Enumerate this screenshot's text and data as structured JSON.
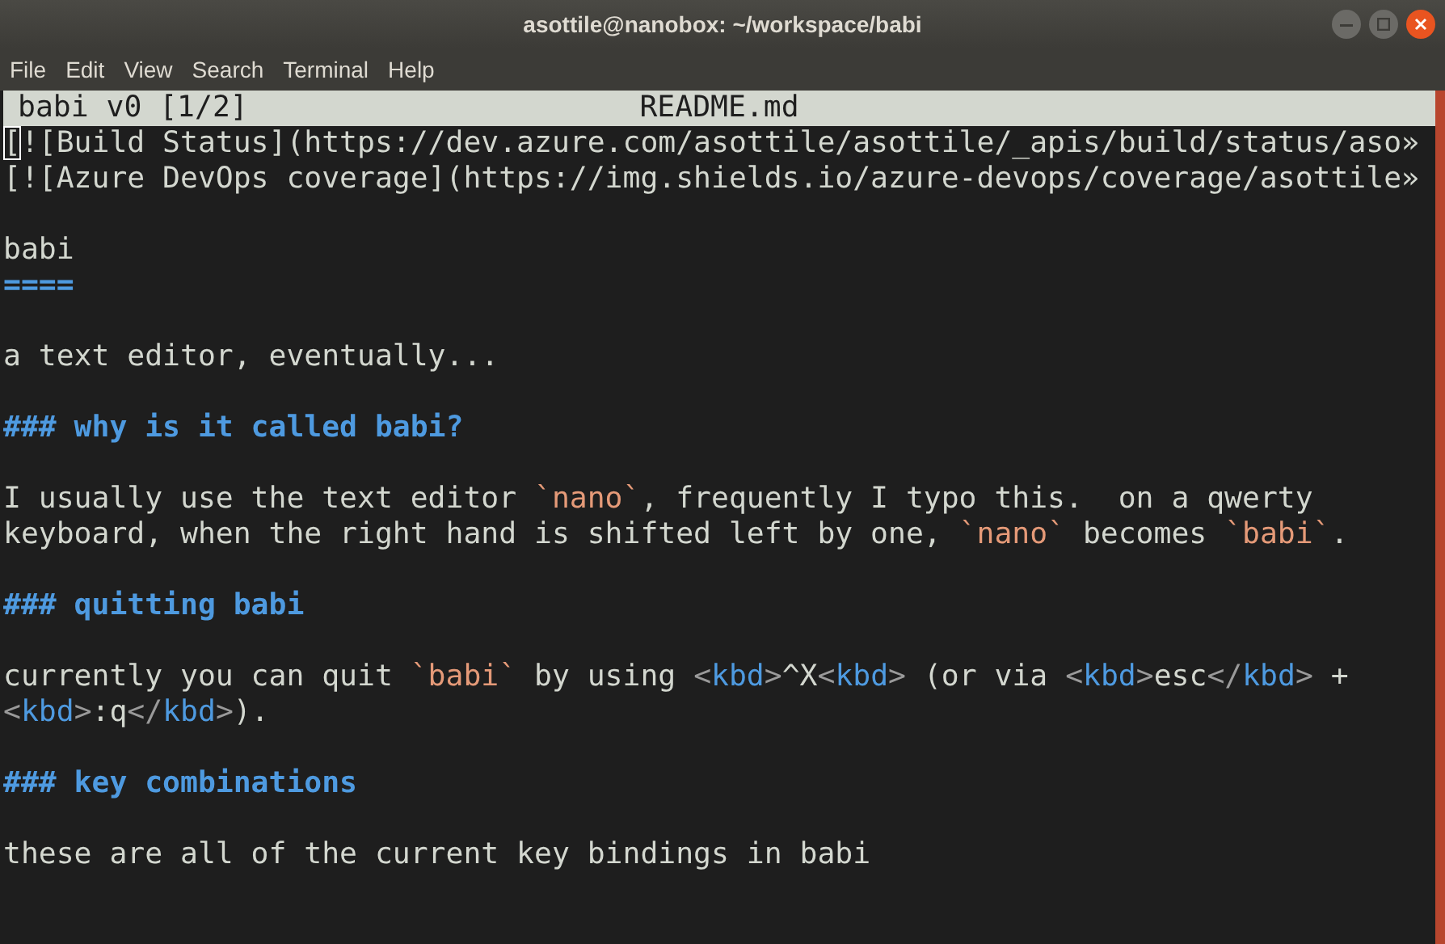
{
  "window": {
    "title": "asottile@nanobox: ~/workspace/babi"
  },
  "menu": [
    "File",
    "Edit",
    "View",
    "Search",
    "Terminal",
    "Help"
  ],
  "header": {
    "left": "babi v0 [1/2]",
    "center": "README.md"
  },
  "lines": [
    {
      "kind": "line",
      "spans": [
        {
          "kind": "cursor",
          "text": "["
        },
        {
          "kind": "text",
          "text": "![Build Status](https://dev.azure.com/asottile/asottile/_apis/build/status/aso»"
        }
      ]
    },
    {
      "kind": "line",
      "spans": [
        {
          "kind": "text",
          "text": "[![Azure DevOps coverage](https://img.shields.io/azure-devops/coverage/asottile»"
        }
      ]
    },
    {
      "kind": "blank"
    },
    {
      "kind": "line",
      "spans": [
        {
          "kind": "text",
          "text": "babi"
        }
      ]
    },
    {
      "kind": "line",
      "spans": [
        {
          "kind": "heading",
          "text": "===="
        }
      ]
    },
    {
      "kind": "blank"
    },
    {
      "kind": "line",
      "spans": [
        {
          "kind": "text",
          "text": "a text editor, eventually..."
        }
      ]
    },
    {
      "kind": "blank"
    },
    {
      "kind": "line",
      "spans": [
        {
          "kind": "heading",
          "text": "### why is it called babi?"
        }
      ]
    },
    {
      "kind": "blank"
    },
    {
      "kind": "line",
      "spans": [
        {
          "kind": "text",
          "text": "I usually use the text editor "
        },
        {
          "kind": "code",
          "text": "`nano`"
        },
        {
          "kind": "text",
          "text": ", frequently I typo this.  on a qwerty"
        }
      ]
    },
    {
      "kind": "line",
      "spans": [
        {
          "kind": "text",
          "text": "keyboard, when the right hand is shifted left by one, "
        },
        {
          "kind": "code",
          "text": "`nano`"
        },
        {
          "kind": "text",
          "text": " becomes "
        },
        {
          "kind": "code",
          "text": "`babi`"
        },
        {
          "kind": "text",
          "text": "."
        }
      ]
    },
    {
      "kind": "blank"
    },
    {
      "kind": "line",
      "spans": [
        {
          "kind": "heading",
          "text": "### quitting babi"
        }
      ]
    },
    {
      "kind": "blank"
    },
    {
      "kind": "line",
      "spans": [
        {
          "kind": "text",
          "text": "currently you can quit "
        },
        {
          "kind": "code",
          "text": "`babi`"
        },
        {
          "kind": "text",
          "text": " by using "
        },
        {
          "kind": "punct",
          "text": "<"
        },
        {
          "kind": "tag",
          "text": "kbd"
        },
        {
          "kind": "punct",
          "text": ">"
        },
        {
          "kind": "text",
          "text": "^X"
        },
        {
          "kind": "punct",
          "text": "<"
        },
        {
          "kind": "tag",
          "text": "kbd"
        },
        {
          "kind": "punct",
          "text": ">"
        },
        {
          "kind": "text",
          "text": " (or via "
        },
        {
          "kind": "punct",
          "text": "<"
        },
        {
          "kind": "tag",
          "text": "kbd"
        },
        {
          "kind": "punct",
          "text": ">"
        },
        {
          "kind": "text",
          "text": "esc"
        },
        {
          "kind": "punct",
          "text": "</"
        },
        {
          "kind": "tag",
          "text": "kbd"
        },
        {
          "kind": "punct",
          "text": ">"
        },
        {
          "kind": "text",
          "text": " +"
        }
      ]
    },
    {
      "kind": "line",
      "spans": [
        {
          "kind": "punct",
          "text": "<"
        },
        {
          "kind": "tag",
          "text": "kbd"
        },
        {
          "kind": "punct",
          "text": ">"
        },
        {
          "kind": "text",
          "text": ":q"
        },
        {
          "kind": "punct",
          "text": "</"
        },
        {
          "kind": "tag",
          "text": "kbd"
        },
        {
          "kind": "punct",
          "text": ">"
        },
        {
          "kind": "text",
          "text": ")."
        }
      ]
    },
    {
      "kind": "blank"
    },
    {
      "kind": "line",
      "spans": [
        {
          "kind": "heading",
          "text": "### key combinations"
        }
      ]
    },
    {
      "kind": "blank"
    },
    {
      "kind": "line",
      "spans": [
        {
          "kind": "text",
          "text": "these are all of the current key bindings in babi"
        }
      ]
    }
  ]
}
